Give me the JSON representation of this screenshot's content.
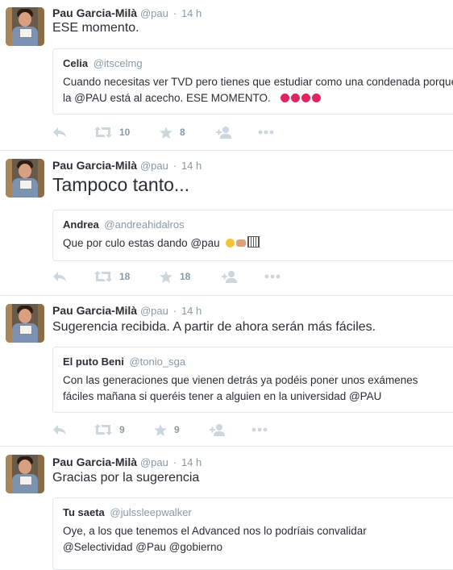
{
  "tweets": [
    {
      "name": "Pau Garcia-Milà",
      "handle": "@pau",
      "sep": "·",
      "time": "14 h",
      "text": "ESE momento.",
      "quote": {
        "name": "Celia",
        "handle": "@itscelmg",
        "text": "Cuando necesitas ver TVD pero tienes que estudiar como una condenada porque la @PAU está al acecho. ESE MOMENTO."
      },
      "retweets": "10",
      "favorites": "8"
    },
    {
      "name": "Pau Garcia-Milà",
      "handle": "@pau",
      "sep": "·",
      "time": "14 h",
      "text": "Tampoco tanto...",
      "quote": {
        "name": "Andrea",
        "handle": "@andreahidalros",
        "text": "Que por culo estas dando @pau"
      },
      "retweets": "18",
      "favorites": "18"
    },
    {
      "name": "Pau Garcia-Milà",
      "handle": "@pau",
      "sep": "·",
      "time": "14 h",
      "text": "Sugerencia recibida. A partir de ahora serán más fáciles.",
      "quote": {
        "name": "El puto Beni",
        "handle": "@tonio_sga",
        "text_line1": "Con las generaciones que vienen detrás ya podéis poner unos exámenes",
        "text_line2": "fáciles mañana si queréis tener a alguien en la universidad @PAU"
      },
      "retweets": "9",
      "favorites": "9"
    },
    {
      "name": "Pau Garcia-Milà",
      "handle": "@pau",
      "sep": "·",
      "time": "14 h",
      "text": "Gracias por la sugerencia",
      "quote": {
        "name": "Tu saeta",
        "handle": "@julssleepwalker",
        "text_line1": "Oye, a los que tenemos el Advanced nos lo podríais convalidar",
        "text_line2": "@Selectividad @Pau @gobierno"
      }
    }
  ],
  "icons": {
    "reply": "reply-icon",
    "retweet": "retweet-icon",
    "favorite": "star-icon",
    "follow": "follow-icon",
    "more": "more-icon"
  },
  "colors": {
    "text": "#292f33",
    "muted": "#8899a6",
    "border": "#e1e8ed"
  }
}
